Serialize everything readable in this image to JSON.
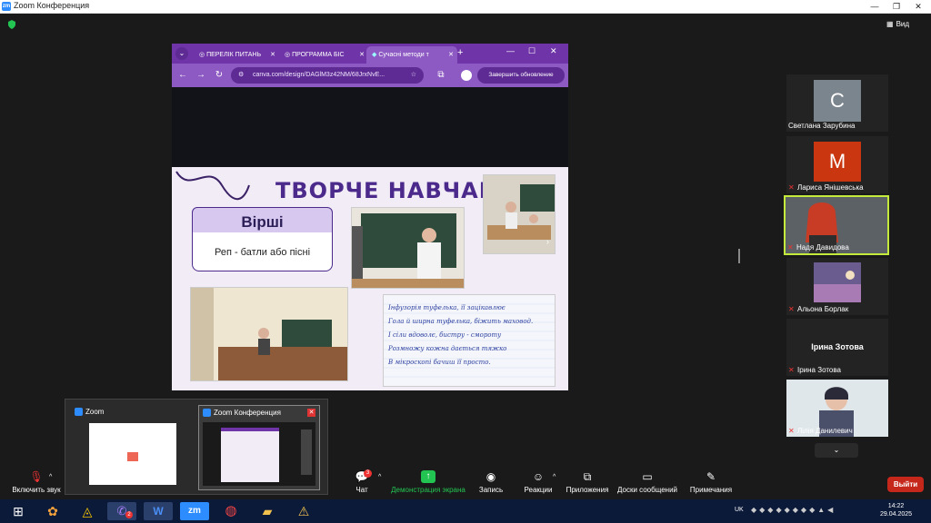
{
  "window": {
    "title": "Zoom Конференция",
    "view_label": "Вид"
  },
  "browser": {
    "tabs": [
      {
        "label": "ПЕРЕЛІК ПИТАНЬ"
      },
      {
        "label": "ПРОГРАММА БІС"
      },
      {
        "label": "Сучасні методи т"
      }
    ],
    "url": "canva.com/design/DAGlM3z42NM/68JrxNvE...",
    "update_button": "Завершить обновление"
  },
  "slide": {
    "title": "ТВОРЧЕ НАВЧАННЯ",
    "card_title": "Вірші",
    "card_text": "Реп - батли або пісні",
    "handwriting": [
      "Інфузорія туфелька, її зацікавлює",
      "Гола й ширна туфелька, біжить маховод.",
      "І сіли вдоволє, бистру - смороту",
      "Розмножу кожна дається тяжко",
      "В мікроскопі бачиш її просто."
    ]
  },
  "participants": [
    {
      "name": "Светлана Зарубина",
      "initial": "С",
      "color": "#7b858e",
      "muted": false
    },
    {
      "name": "Лариса Янішевська",
      "initial": "М",
      "color": "#c9360f",
      "muted": true
    },
    {
      "name": "Надя Давидова",
      "initial": "",
      "color": "",
      "muted": true
    },
    {
      "name": "Альона Борлак",
      "initial": "",
      "color": "",
      "muted": true
    },
    {
      "name": "Ірина Зотова",
      "initial": "",
      "color": "",
      "muted": true,
      "big_name": "Ірина Зотова"
    },
    {
      "name": "Лілія Данилевич",
      "initial": "",
      "color": "",
      "muted": true
    }
  ],
  "toolbar": {
    "audio": "Включить звук",
    "chat": "Чат",
    "chat_badge": "3",
    "share": "Демонстрация экрана",
    "record": "Запись",
    "reactions": "Реакции",
    "apps": "Приложения",
    "whiteboard": "Доски сообщений",
    "notes": "Примечания",
    "leave": "Выйти"
  },
  "switcher": {
    "items": [
      {
        "title": "Zoom"
      },
      {
        "title": "Zoom Конференция"
      }
    ]
  },
  "taskbar": {
    "lang": "UK",
    "time": "14:22",
    "date": "29.04.2025",
    "viber_badge": "2"
  },
  "colors": {
    "accent_purple": "#6f35a8",
    "zoom_blue": "#2d8cff",
    "leave_red": "#c5271b",
    "share_green": "#23c552"
  }
}
